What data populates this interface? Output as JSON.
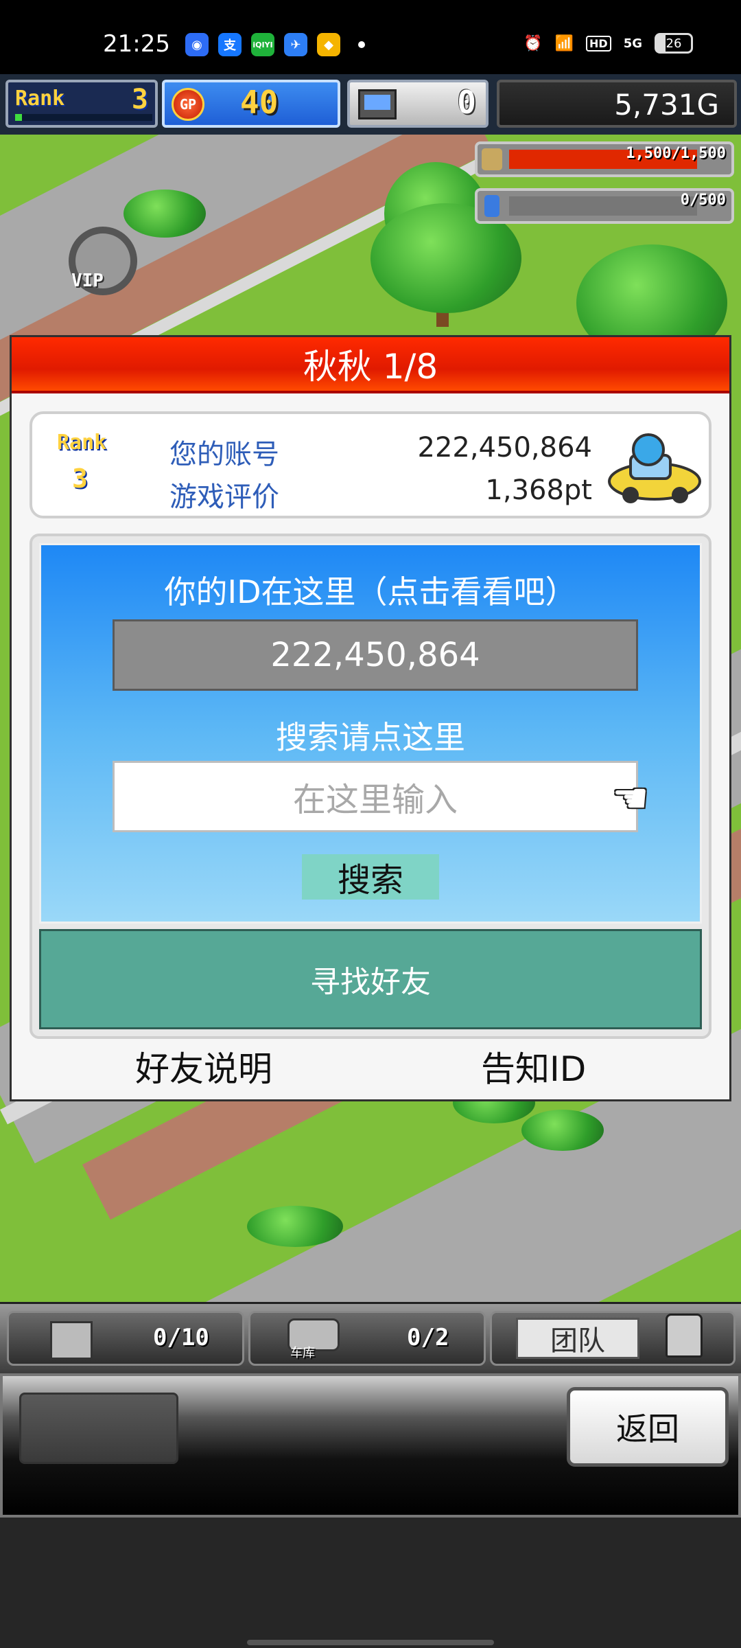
{
  "status_bar": {
    "time": "21:25",
    "apps": [
      {
        "icon": "circle-app-icon",
        "glyph": "◉",
        "color": "#2d6cf5"
      },
      {
        "icon": "alipay-icon",
        "glyph": "支",
        "color": "#1677ff"
      },
      {
        "icon": "iqiyi-icon",
        "glyph": "iQIYI",
        "color": "#1fb23a"
      },
      {
        "icon": "travel-app-icon",
        "glyph": "✈",
        "color": "#2d7ef5"
      },
      {
        "icon": "shield-app-icon",
        "glyph": "◆",
        "color": "#f5b400"
      }
    ],
    "signal": "5G",
    "hd_label": "HD",
    "battery": "26",
    "battery_level": 0.26
  },
  "hud": {
    "rank_label": "Rank",
    "rank_value": "3",
    "rank_progress": 0.05,
    "gp_label": "GP",
    "gp_value": "40",
    "pc_value": "0",
    "money": "5,731G"
  },
  "gauges": [
    {
      "icon": "coin-stack-icon",
      "text": "1,500/1,500",
      "fill": 1.0,
      "color": "#e02800"
    },
    {
      "icon": "fuel-bottle-icon",
      "text": "0/500",
      "fill": 0.0,
      "color": "#3a7be0"
    }
  ],
  "map": {
    "vip_label": "VIP"
  },
  "dialog": {
    "title": "秋秋 1/8",
    "rank_label": "Rank",
    "rank_value": "3",
    "account_label": "您的账号",
    "account_value": "222,450,864",
    "rating_label": "游戏评价",
    "rating_value": "1,368pt",
    "id_hint": "你的ID在这里（点击看看吧）",
    "id_value": "222,450,864",
    "search_hint": "搜索请点这里",
    "search_placeholder": "在这里输入",
    "search_button": "搜索",
    "find_friends": "寻找好友",
    "friend_help": "好友说明",
    "share_id": "告知ID"
  },
  "bottom_hud": {
    "slot1_count": "0/10",
    "garage_label": "车库",
    "slot2_count": "0/2",
    "team_label": "团队"
  },
  "bottom_panel": {
    "back_button": "返回"
  }
}
